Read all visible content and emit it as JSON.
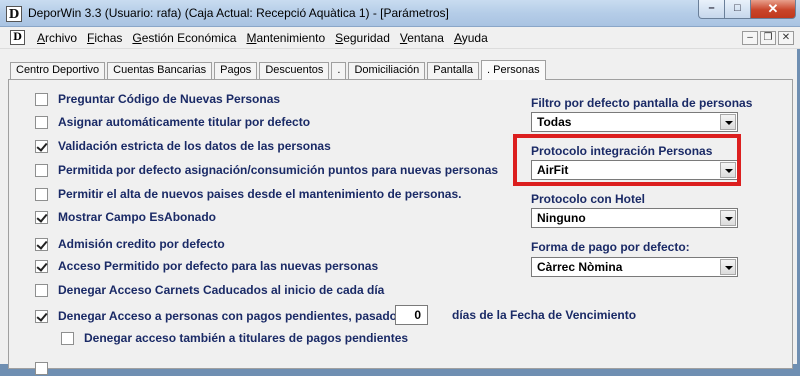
{
  "window": {
    "title": "DeporWin 3.3  (Usuario: rafa)  (Caja Actual: Recepció Aquàtica 1) - [Parámetros]",
    "app_icon": "D",
    "controls": {
      "minimize": "–",
      "maximize": "□",
      "close": "✕"
    }
  },
  "menubar": {
    "icon": "D",
    "items": [
      "Archivo",
      "Fichas",
      "Gestión Económica",
      "Mantenimiento",
      "Seguridad",
      "Ventana",
      "Ayuda"
    ],
    "mdi_controls": {
      "minimize": "–",
      "restore": "❐",
      "close": "✕"
    }
  },
  "tabs": [
    {
      "label": "Centro Deportivo",
      "active": false
    },
    {
      "label": "Cuentas Bancarias",
      "active": false
    },
    {
      "label": "Pagos",
      "active": false
    },
    {
      "label": "Descuentos",
      "active": false
    },
    {
      "label": ".",
      "active": false
    },
    {
      "label": "Domiciliación",
      "active": false
    },
    {
      "label": "Pantalla",
      "active": false
    },
    {
      "label": ". Personas",
      "active": true
    }
  ],
  "options": [
    {
      "label": "Preguntar Código de Nuevas Personas",
      "checked": false
    },
    {
      "label": "Asignar automáticamente titular por defecto",
      "checked": false
    },
    {
      "label": "Validación estricta de los datos de las personas",
      "checked": true
    },
    {
      "label": "Permitida por defecto asignación/consumición puntos para nuevas personas",
      "checked": false
    },
    {
      "label": "Permitir el alta de nuevos paises desde el mantenimiento de personas.",
      "checked": false
    },
    {
      "label": "Mostrar Campo EsAbonado",
      "checked": true
    },
    {
      "label": "Admisión credito por defecto",
      "checked": true
    },
    {
      "label": "Acceso Permitido por defecto para las nuevas personas",
      "checked": true
    },
    {
      "label": "Denegar Acceso Carnets Caducados al inicio de cada día",
      "checked": false
    },
    {
      "label": "Denegar Acceso a personas con pagos pendientes, pasados",
      "checked": true
    },
    {
      "label": "Denegar acceso también a titulares de pagos pendientes",
      "checked": false
    }
  ],
  "pending_days": {
    "value": "0",
    "suffix": "días de la Fecha de Vencimiento"
  },
  "right_fields": [
    {
      "label": "Filtro por defecto pantalla de personas",
      "value": "Todas"
    },
    {
      "label": "Protocolo integración Personas",
      "value": "AirFit"
    },
    {
      "label": "Protocolo con Hotel",
      "value": "Ninguno"
    },
    {
      "label": "Forma de pago por defecto:",
      "value": "Càrrec Nòmina"
    }
  ],
  "accent": {
    "highlight": "#dc1f1f",
    "label_color": "#1a2a66"
  }
}
